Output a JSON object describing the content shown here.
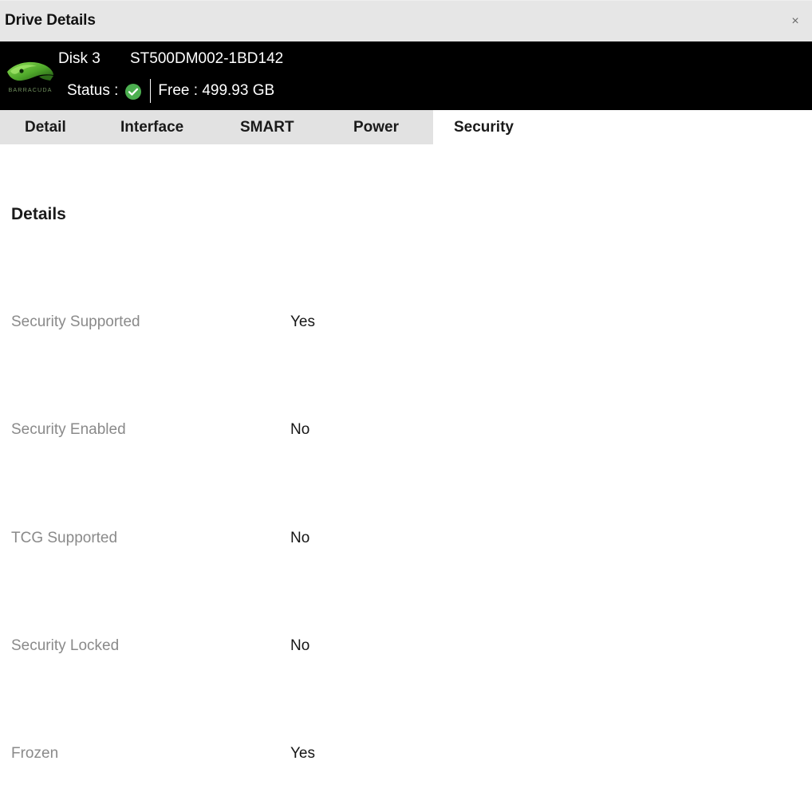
{
  "window": {
    "title": "Drive Details",
    "close_label": "×"
  },
  "drive_header": {
    "brand": "BARRACUDA",
    "disk_number": "Disk 3",
    "model": "ST500DM002-1BD142",
    "status_label": "Status :",
    "status_icon": "check-circle-icon",
    "status_color": "#4caf50",
    "free_label": "Free : 499.93 GB"
  },
  "tabs": [
    {
      "label": "Detail",
      "active": false
    },
    {
      "label": "Interface",
      "active": false
    },
    {
      "label": "SMART",
      "active": false
    },
    {
      "label": "Power",
      "active": false
    },
    {
      "label": "Security",
      "active": true
    }
  ],
  "content": {
    "section_title": "Details",
    "rows": [
      {
        "label": "Security Supported",
        "value": "Yes"
      },
      {
        "label": "Security Enabled",
        "value": "No"
      },
      {
        "label": "TCG Supported",
        "value": "No"
      },
      {
        "label": "Security Locked",
        "value": "No"
      },
      {
        "label": "Frozen",
        "value": "Yes"
      }
    ]
  },
  "colors": {
    "titlebar_bg": "#e6e6e6",
    "header_bg": "#000000",
    "tabstrip_bg": "#e2e2e2",
    "content_bg": "#ffffff",
    "label_text": "#8a8a8a",
    "value_text": "#151515",
    "accent_green": "#4caf50"
  }
}
